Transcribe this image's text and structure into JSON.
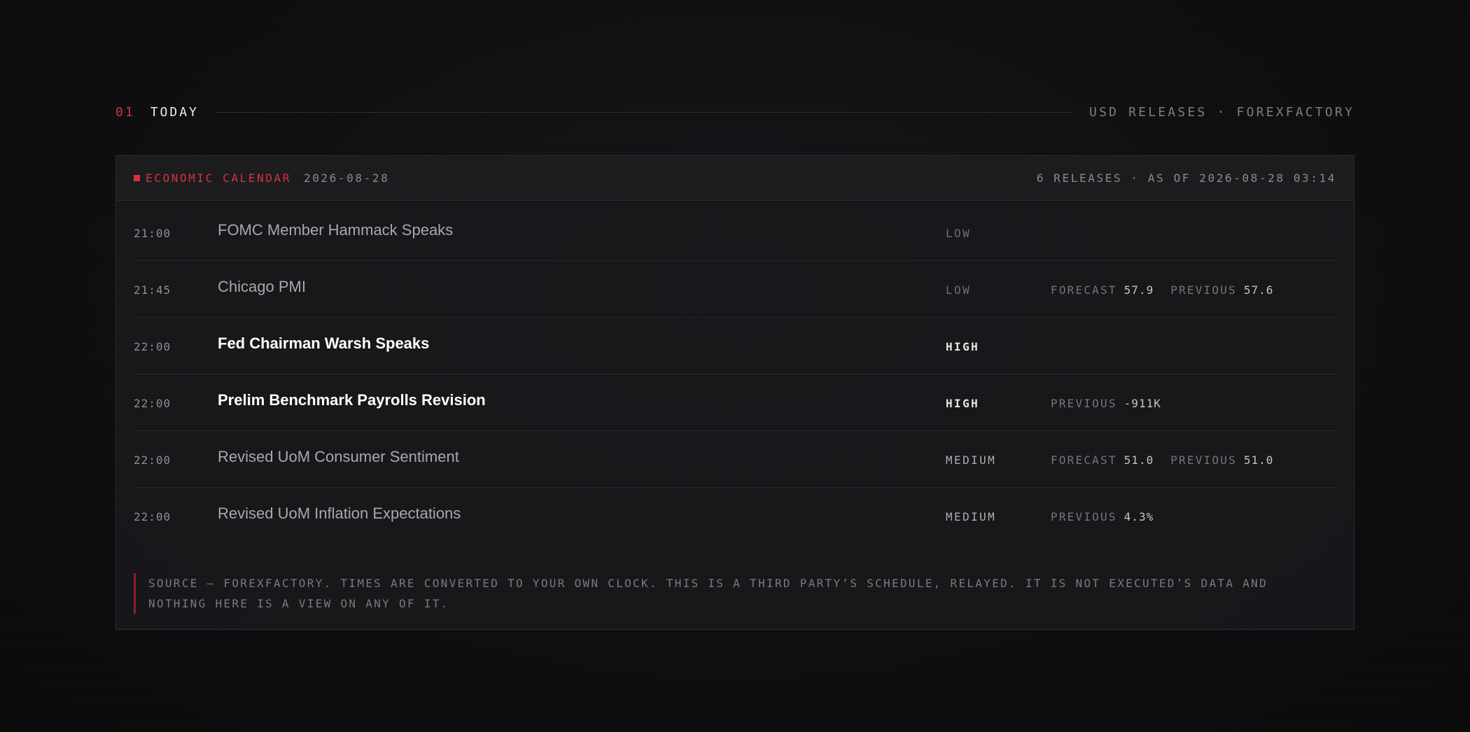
{
  "section": {
    "number": "01",
    "title": "TODAY",
    "right_label": "USD RELEASES · FOREXFACTORY"
  },
  "panel": {
    "label": "ECONOMIC CALENDAR",
    "date": "2026-08-28",
    "summary": "6 RELEASES · AS OF 2026-08-28 03:14",
    "accent_color": "#d8323a"
  },
  "events": [
    {
      "time": "21:00",
      "name": "FOMC Member Hammack Speaks",
      "impact": "LOW",
      "level": "low",
      "figures": []
    },
    {
      "time": "21:45",
      "name": "Chicago PMI",
      "impact": "LOW",
      "level": "low",
      "figures": [
        {
          "label": "FORECAST",
          "value": "57.9"
        },
        {
          "label": "PREVIOUS",
          "value": "57.6"
        }
      ]
    },
    {
      "time": "22:00",
      "name": "Fed Chairman Warsh Speaks",
      "impact": "HIGH",
      "level": "high",
      "figures": []
    },
    {
      "time": "22:00",
      "name": "Prelim Benchmark Payrolls Revision",
      "impact": "HIGH",
      "level": "high",
      "figures": [
        {
          "label": "PREVIOUS",
          "value": "-911K"
        }
      ]
    },
    {
      "time": "22:00",
      "name": "Revised UoM Consumer Sentiment",
      "impact": "MEDIUM",
      "level": "medium",
      "figures": [
        {
          "label": "FORECAST",
          "value": "51.0"
        },
        {
          "label": "PREVIOUS",
          "value": "51.0"
        }
      ]
    },
    {
      "time": "22:00",
      "name": "Revised UoM Inflation Expectations",
      "impact": "MEDIUM",
      "level": "medium",
      "figures": [
        {
          "label": "PREVIOUS",
          "value": "4.3%"
        }
      ]
    }
  ],
  "footnote": {
    "line1": "SOURCE — FOREXFACTORY. TIMES ARE CONVERTED TO YOUR OWN CLOCK. THIS IS A THIRD PARTY’S SCHEDULE, RELAYED. IT IS NOT EXECUTED’S DATA AND",
    "line2": "NOTHING HERE IS A VIEW ON ANY OF IT."
  }
}
